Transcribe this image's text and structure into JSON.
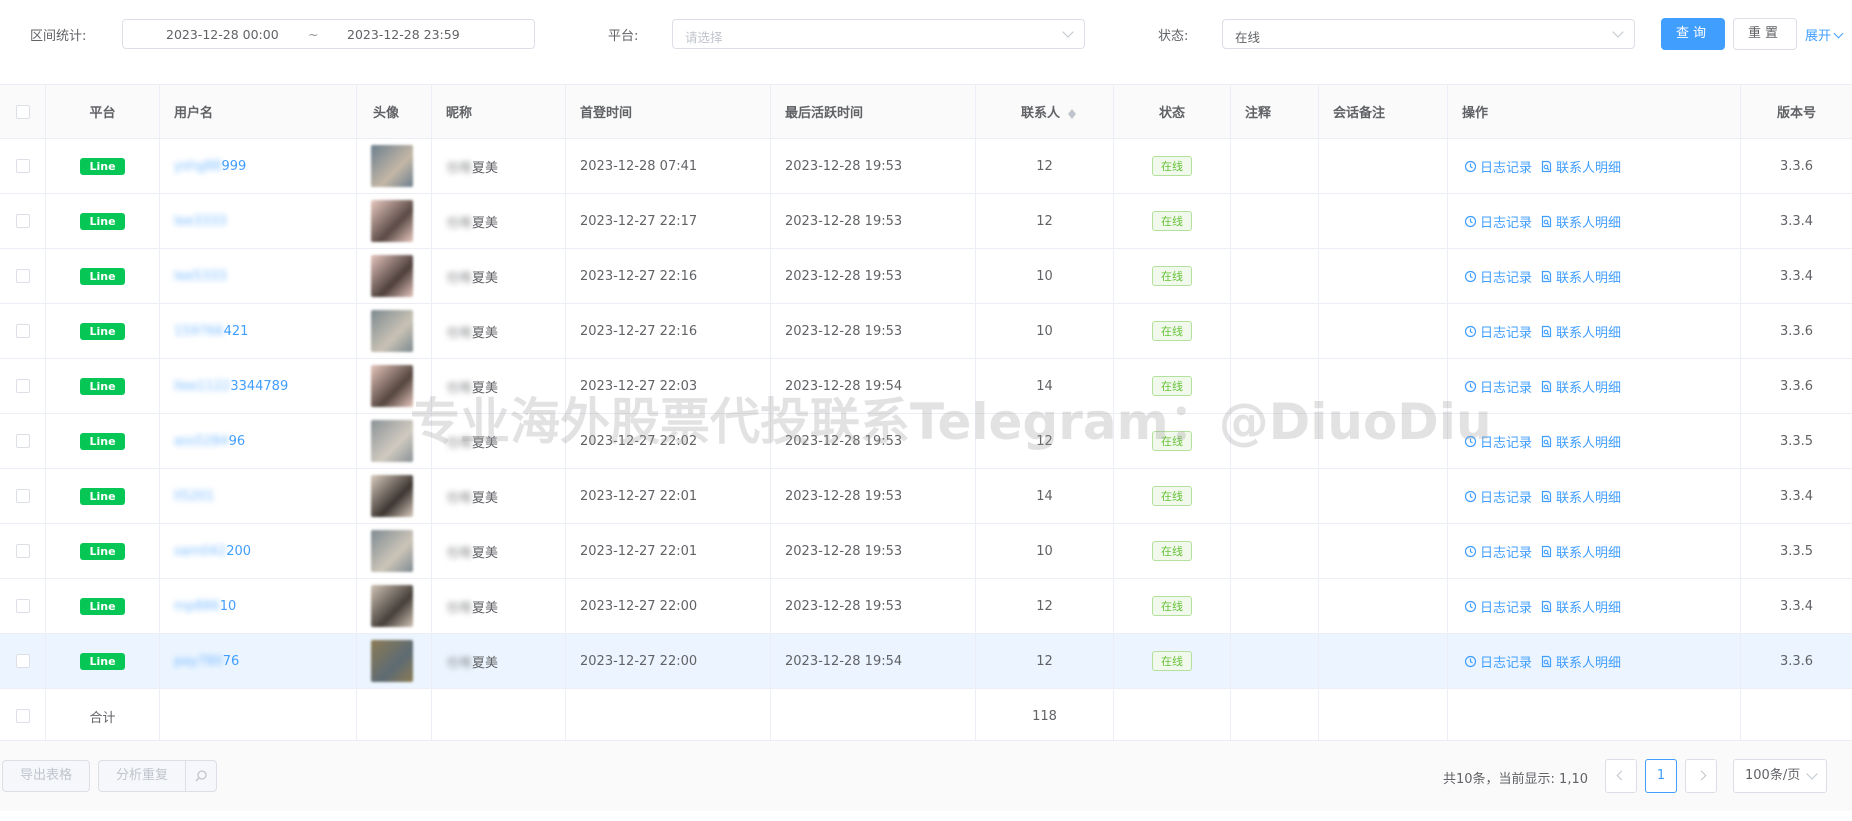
{
  "filters": {
    "range_label": "区间统计:",
    "date_start": "2023-12-28 00:00",
    "date_sep": "~",
    "date_end": "2023-12-28 23:59",
    "platform_label": "平台:",
    "platform_placeholder": "请选择",
    "status_label": "状态:",
    "status_value": "在线",
    "query_button": "查询",
    "reset_button": "重置",
    "expand_link": "展开"
  },
  "table": {
    "headers": {
      "platform": "平台",
      "username": "用户名",
      "avatar": "头像",
      "nickname": "昵称",
      "first_login": "首登时间",
      "last_active": "最后活跃时间",
      "contacts": "联系人",
      "status": "状态",
      "note": "注释",
      "session_note": "会话备注",
      "actions": "操作",
      "version": "版本号"
    },
    "action_log": "日志记录",
    "action_contacts": "联系人明细",
    "rows": [
      {
        "platform": "Line",
        "user_hidden": "yshg88",
        "user_visible": "999",
        "nick_hidden": "也唯",
        "nick_visible": "夏美",
        "first": "2023-12-28 07:41",
        "last": "2023-12-28 19:53",
        "contacts": "12",
        "status": "在线",
        "version": "3.3.6",
        "avatar_colors": [
          "#6b7f8e",
          "#c4b7a6"
        ]
      },
      {
        "platform": "Line",
        "user_hidden": "lee3333",
        "user_visible": "",
        "nick_hidden": "也唯",
        "nick_visible": "夏美",
        "first": "2023-12-27 22:17",
        "last": "2023-12-28 19:53",
        "contacts": "12",
        "status": "在线",
        "version": "3.3.4",
        "avatar_colors": [
          "#e8c9c0",
          "#5a4a45"
        ]
      },
      {
        "platform": "Line",
        "user_hidden": "lee5333",
        "user_visible": "",
        "nick_hidden": "也唯",
        "nick_visible": "夏美",
        "first": "2023-12-27 22:16",
        "last": "2023-12-28 19:53",
        "contacts": "10",
        "status": "在线",
        "version": "3.3.4",
        "avatar_colors": [
          "#e5c4bd",
          "#4e403c"
        ]
      },
      {
        "platform": "Line",
        "user_hidden": "159766",
        "user_visible": "421",
        "nick_hidden": "也唯",
        "nick_visible": "夏美",
        "first": "2023-12-27 22:16",
        "last": "2023-12-28 19:53",
        "contacts": "10",
        "status": "在线",
        "version": "3.3.6",
        "avatar_colors": [
          "#7d8a8f",
          "#c9c2b5"
        ]
      },
      {
        "platform": "Line",
        "user_hidden": "llee1122",
        "user_visible": "3344789",
        "nick_hidden": "也唯",
        "nick_visible": "夏美",
        "first": "2023-12-27 22:03",
        "last": "2023-12-28 19:54",
        "contacts": "14",
        "status": "在线",
        "version": "3.3.6",
        "avatar_colors": [
          "#e6c6bd",
          "#54463f"
        ]
      },
      {
        "platform": "Line",
        "user_hidden": "ass5284",
        "user_visible": "96",
        "nick_hidden": "也唯",
        "nick_visible": "夏美",
        "first": "2023-12-27 22:02",
        "last": "2023-12-28 19:53",
        "contacts": "12",
        "status": "在线",
        "version": "3.3.5",
        "avatar_colors": [
          "#8a9296",
          "#d0cac0"
        ]
      },
      {
        "platform": "Line",
        "user_hidden": "ll5201",
        "user_visible": "",
        "nick_hidden": "也唯",
        "nick_visible": "夏美",
        "first": "2023-12-27 22:01",
        "last": "2023-12-28 19:53",
        "contacts": "14",
        "status": "在线",
        "version": "3.3.4",
        "avatar_colors": [
          "#d9cbbd",
          "#3d3632"
        ]
      },
      {
        "platform": "Line",
        "user_hidden": "sam042",
        "user_visible": "200",
        "nick_hidden": "也唯",
        "nick_visible": "夏美",
        "first": "2023-12-27 22:01",
        "last": "2023-12-28 19:53",
        "contacts": "10",
        "status": "在线",
        "version": "3.3.5",
        "avatar_colors": [
          "#7f8b92",
          "#ccc5b8"
        ]
      },
      {
        "platform": "Line",
        "user_hidden": "mp886",
        "user_visible": "10",
        "nick_hidden": "也唯",
        "nick_visible": "夏美",
        "first": "2023-12-27 22:00",
        "last": "2023-12-28 19:53",
        "contacts": "12",
        "status": "在线",
        "version": "3.3.4",
        "avatar_colors": [
          "#cfc2b4",
          "#46403a"
        ]
      },
      {
        "platform": "Line",
        "user_hidden": "pay780",
        "user_visible": "76",
        "nick_hidden": "也唯",
        "nick_visible": "夏美",
        "first": "2023-12-27 22:00",
        "last": "2023-12-28 19:54",
        "contacts": "12",
        "status": "在线",
        "version": "3.3.6",
        "avatar_colors": [
          "#8c7b55",
          "#5d6b73"
        ]
      }
    ],
    "sum_row": {
      "label": "合计",
      "contacts": "118"
    }
  },
  "footer": {
    "export_button": "导出表格",
    "analyze_button": "分析重复",
    "total_text": "共10条，当前显示: 1,10",
    "current_page": "1",
    "page_size": "100条/页"
  },
  "watermark": "专业海外股票代投联系Telegram：@DiuoDiu",
  "colors": {
    "accent": "#409eff",
    "line_green": "#06c755",
    "online_green": "#67c23a",
    "highlight_row": "#ecf5ff"
  }
}
